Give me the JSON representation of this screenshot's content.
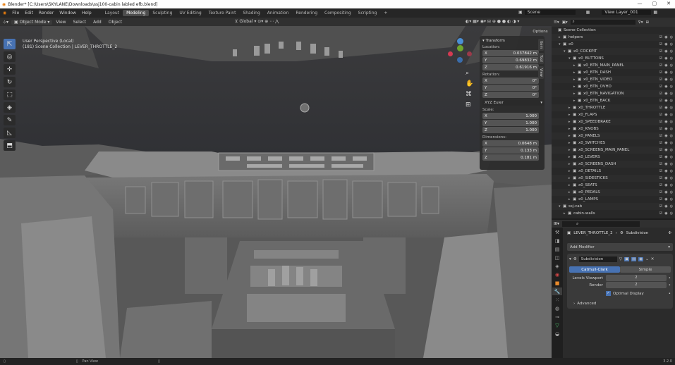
{
  "window": {
    "title": "Blender* [C:\\Users\\SKYLANE\\Downloads\\ssj100-cabin labled efb.blend]"
  },
  "menu": [
    "File",
    "Edit",
    "Render",
    "Window",
    "Help"
  ],
  "workspaces": [
    "Layout",
    "Modeling",
    "Sculpting",
    "UV Editing",
    "Texture Paint",
    "Shading",
    "Animation",
    "Rendering",
    "Compositing",
    "Scripting"
  ],
  "active_workspace": "Modeling",
  "scene": {
    "scene_name": "Scene",
    "view_layer": "View Layer_001"
  },
  "viewport": {
    "mode": "Object Mode",
    "menus": [
      "View",
      "Select",
      "Add",
      "Object"
    ],
    "transform_orient": "Global",
    "options": "Options",
    "info_line1": "User Perspective (Local)",
    "info_line2": "(181) Scene Collection | LEVER_THROTTLE_2"
  },
  "npanel": {
    "title": "Transform",
    "location_label": "Location:",
    "location": [
      {
        "axis": "X",
        "value": "0.037842 m"
      },
      {
        "axis": "Y",
        "value": "0.69832 m"
      },
      {
        "axis": "Z",
        "value": "0.61916 m"
      }
    ],
    "rotation_label": "Rotation:",
    "rotation": [
      {
        "axis": "X",
        "value": "0°"
      },
      {
        "axis": "Y",
        "value": "0°"
      },
      {
        "axis": "Z",
        "value": "0°"
      }
    ],
    "rotation_mode": "XYZ Euler",
    "scale_label": "Scale:",
    "scale": [
      {
        "axis": "X",
        "value": "1.000"
      },
      {
        "axis": "Y",
        "value": "1.000"
      },
      {
        "axis": "Z",
        "value": "1.000"
      }
    ],
    "dimensions_label": "Dimensions:",
    "dimensions": [
      {
        "axis": "X",
        "value": "0.0648 m"
      },
      {
        "axis": "Y",
        "value": "0.133 m"
      },
      {
        "axis": "Z",
        "value": "0.181 m"
      }
    ],
    "tabs": [
      "Item",
      "Tool",
      "View"
    ]
  },
  "outliner": {
    "rows": [
      {
        "label": "Scene Collection",
        "indent": 0,
        "tri": ""
      },
      {
        "label": "helpers",
        "indent": 1,
        "tri": "▸"
      },
      {
        "label": "x0",
        "indent": 1,
        "tri": "▾"
      },
      {
        "label": "x0_COCKPIT",
        "indent": 2,
        "tri": "▾"
      },
      {
        "label": "x0_BUTTONS",
        "indent": 3,
        "tri": "▾"
      },
      {
        "label": "x0_BTN_MAIN_PANEL",
        "indent": 4,
        "tri": "▸"
      },
      {
        "label": "x0_BTN_DASH",
        "indent": 4,
        "tri": "▸"
      },
      {
        "label": "x0_BTN_VIDEO",
        "indent": 4,
        "tri": "▸"
      },
      {
        "label": "x0_BTN_OVHD",
        "indent": 4,
        "tri": "▸"
      },
      {
        "label": "x0_BTN_NAVIGATION",
        "indent": 4,
        "tri": "▸"
      },
      {
        "label": "x0_BTN_BACK",
        "indent": 4,
        "tri": "▸"
      },
      {
        "label": "x0_THROTTLE",
        "indent": 3,
        "tri": "▸"
      },
      {
        "label": "x0_FLAPS",
        "indent": 3,
        "tri": "▸"
      },
      {
        "label": "x0_SPEEDBRAKE",
        "indent": 3,
        "tri": "▸"
      },
      {
        "label": "x0_KNOBS",
        "indent": 3,
        "tri": "▸"
      },
      {
        "label": "x0_PANELS",
        "indent": 3,
        "tri": "▸"
      },
      {
        "label": "x0_SWITCHES",
        "indent": 3,
        "tri": "▸"
      },
      {
        "label": "x0_SCREENS_MAIN_PANEL",
        "indent": 3,
        "tri": "▸"
      },
      {
        "label": "x0_LEVERS",
        "indent": 3,
        "tri": "▸"
      },
      {
        "label": "x0_SCREENS_DASH",
        "indent": 3,
        "tri": "▸"
      },
      {
        "label": "x0_DETAILS",
        "indent": 3,
        "tri": "▸"
      },
      {
        "label": "x0_SIDESTICKS",
        "indent": 3,
        "tri": "▸"
      },
      {
        "label": "x0_SEATS",
        "indent": 3,
        "tri": "▸"
      },
      {
        "label": "x0_PEDALS",
        "indent": 3,
        "tri": "▸"
      },
      {
        "label": "x0_LAMPS",
        "indent": 3,
        "tri": "▸"
      },
      {
        "label": "ssj-cab",
        "indent": 1,
        "tri": "▾"
      },
      {
        "label": "cabin-walls",
        "indent": 2,
        "tri": "▸"
      }
    ]
  },
  "properties": {
    "object_name": "LEVER_THROTTLE_2",
    "modifier_crumb": "Subdivision",
    "add_modifier": "Add Modifier",
    "modifier_name": "Subdivision",
    "algo_options": [
      "Catmull-Clark",
      "Simple"
    ],
    "levels_viewport_label": "Levels Viewport",
    "levels_viewport": "2",
    "render_label": "Render",
    "render": "2",
    "optimal_display": "Optimal Display",
    "advanced": "Advanced"
  },
  "statusbar": {
    "pan": "Pan View",
    "version": "3.2.0"
  }
}
